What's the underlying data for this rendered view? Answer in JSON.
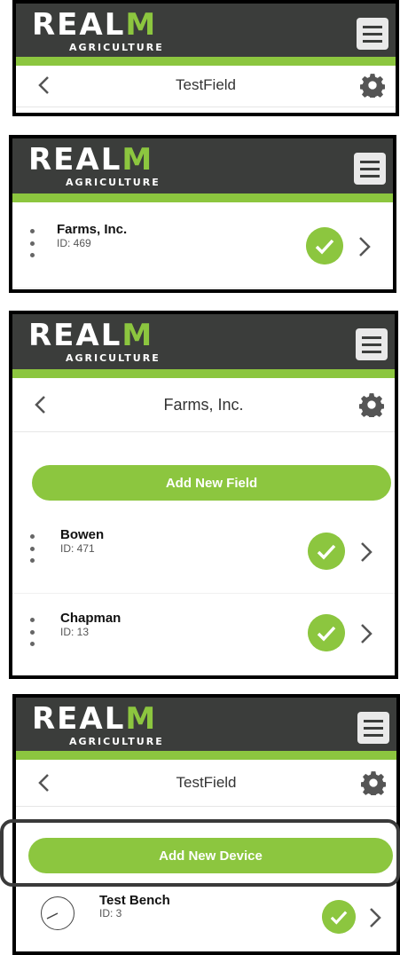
{
  "brand": {
    "logo_word_a": "REAL",
    "logo_word_b": "M",
    "logo_sub": "AGRICULTURE"
  },
  "colors": {
    "header_bg": "#3b3d3b",
    "accent": "#8cc63f",
    "white": "#ffffff"
  },
  "icons": {
    "menu": "hamburger-icon",
    "back": "chevron-left-icon",
    "settings": "gear-icon",
    "status": "check-circle-icon",
    "open": "chevron-right-icon",
    "drag": "vertical-dots-icon",
    "device": "gauge-icon"
  },
  "screen1": {
    "title": "TestField"
  },
  "screen2": {
    "items": [
      {
        "name": "Farms, Inc.",
        "id_label": "ID: 469"
      }
    ]
  },
  "screen3": {
    "title": "Farms, Inc.",
    "add_label": "Add New Field",
    "items": [
      {
        "name": "Bowen",
        "id_label": "ID: 471"
      },
      {
        "name": "Chapman",
        "id_label": "ID: 13"
      }
    ]
  },
  "screen4": {
    "title": "TestField",
    "add_label": "Add New Device",
    "items": [
      {
        "name": "Test Bench",
        "id_label": "ID: 3"
      }
    ]
  }
}
